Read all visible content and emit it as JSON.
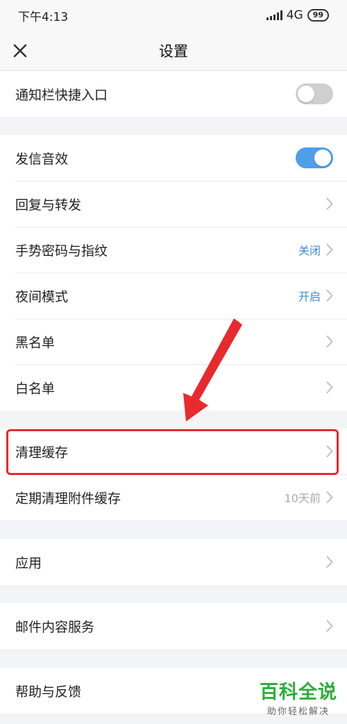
{
  "status_bar": {
    "time": "下午4:13",
    "network": "4G",
    "battery": "99"
  },
  "header": {
    "title": "设置",
    "close_icon": "close-icon"
  },
  "sections": [
    [
      {
        "label": "通知栏快捷入口",
        "control": "toggle",
        "on": false
      }
    ],
    [
      {
        "label": "发信音效",
        "control": "toggle",
        "on": true
      },
      {
        "label": "回复与转发",
        "control": "chevron"
      },
      {
        "label": "手势密码与指纹",
        "control": "chevron",
        "value": "关闭"
      },
      {
        "label": "夜间模式",
        "control": "chevron",
        "value": "开启"
      },
      {
        "label": "黑名单",
        "control": "chevron"
      },
      {
        "label": "白名单",
        "control": "chevron"
      }
    ],
    [
      {
        "label": "清理缓存",
        "control": "chevron"
      },
      {
        "label": "定期清理附件缓存",
        "control": "chevron",
        "value": "10天前"
      }
    ],
    [
      {
        "label": "应用",
        "control": "chevron"
      }
    ],
    [
      {
        "label": "邮件内容服务",
        "control": "chevron"
      }
    ],
    [
      {
        "label": "帮助与反馈",
        "control": "chevron"
      }
    ]
  ],
  "watermark": {
    "logo": "百科全说",
    "subtitle": "助你轻松解决"
  },
  "colors": {
    "accent": "#4f9ee8",
    "value_blue": "#3d8bd8",
    "annotation_red": "#e8292e",
    "watermark_green": "#2eae3b"
  }
}
